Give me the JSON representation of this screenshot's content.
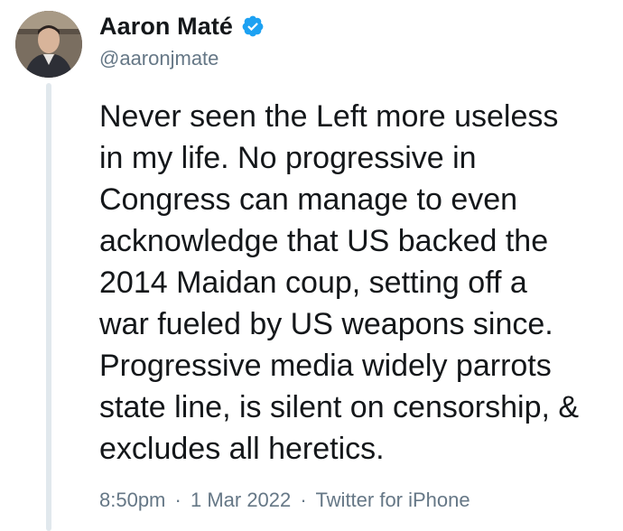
{
  "author": {
    "display_name": "Aaron Maté",
    "handle": "@aaronjmate",
    "verified": true,
    "avatar_icon": "profile-photo-avatar"
  },
  "tweet": {
    "lines": [
      "Never seen the Left more useless",
      "in my life. No progressive in",
      "Congress can manage to even",
      "acknowledge that US backed the",
      "2014 Maidan coup, setting off a",
      "war fueled by US weapons since.",
      "Progressive media widely parrots",
      "state line, is silent on censorship, &",
      "excludes all heretics."
    ]
  },
  "meta": {
    "time": "8:50pm",
    "separator": "·",
    "date": "1 Mar 2022",
    "source": "Twitter for iPhone"
  },
  "colors": {
    "verified_badge": "#1da1f2",
    "secondary_text": "#657786",
    "thread_line": "#e1e8ed"
  }
}
